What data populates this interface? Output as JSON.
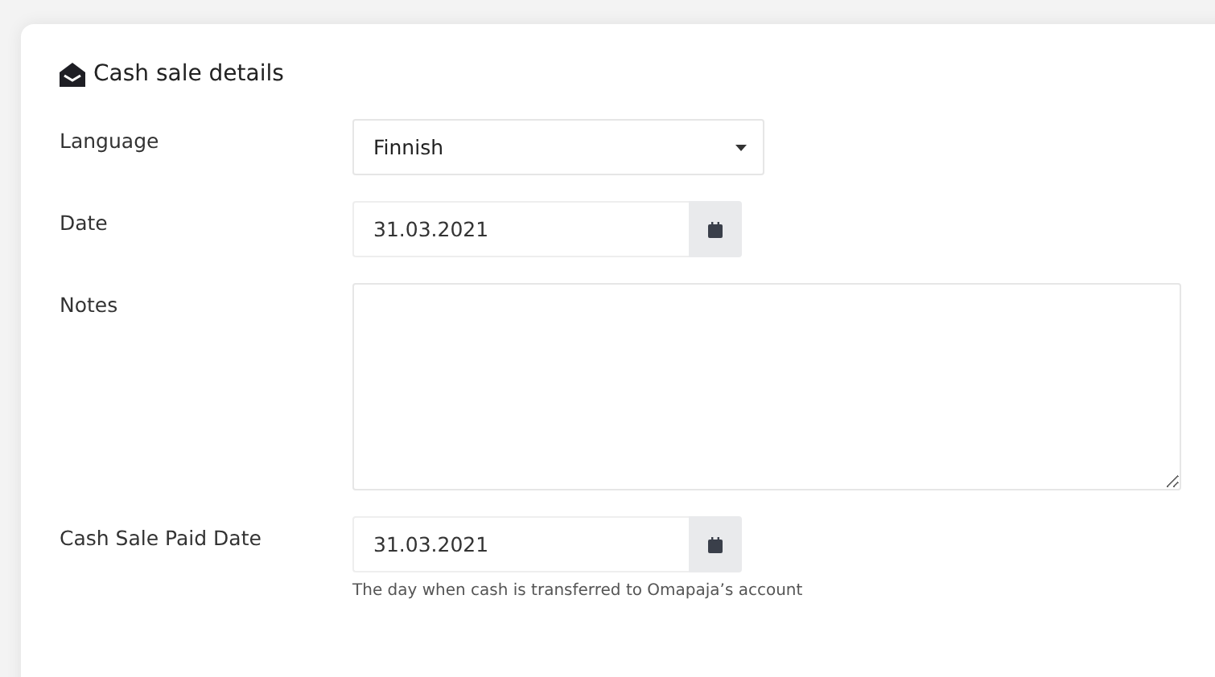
{
  "card": {
    "title": "Cash sale details"
  },
  "fields": [
    {
      "kind": "select",
      "label": "Language",
      "value": "Finnish"
    },
    {
      "kind": "date",
      "label": "Date",
      "value": "31.03.2021"
    },
    {
      "kind": "textarea",
      "label": "Notes"
    },
    {
      "kind": "date",
      "label": "Cash Sale Paid Date",
      "value": "31.03.2021",
      "hint": "The day when cash is transferred to Omapaja’s account"
    }
  ]
}
